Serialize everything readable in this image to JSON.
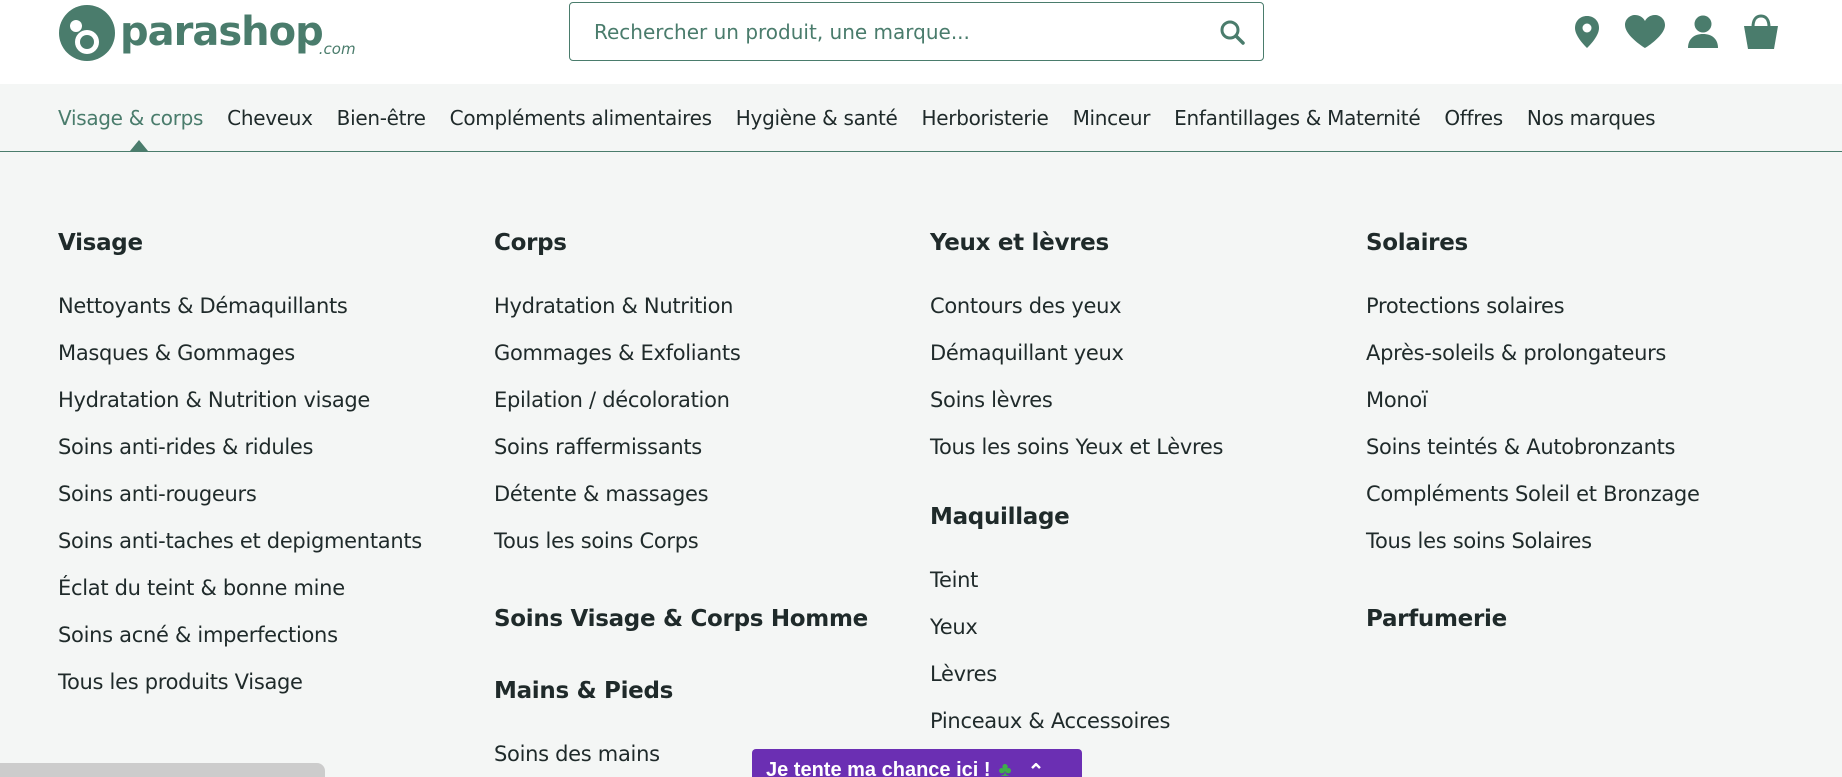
{
  "brand": {
    "name": "parashop",
    "suffix": ".com"
  },
  "search": {
    "placeholder": "Rechercher un produit, une marque..."
  },
  "header_icons": [
    "location-icon",
    "heart-icon",
    "user-icon",
    "basket-icon"
  ],
  "colors": {
    "accent": "#4a7c6c",
    "promo": "#6b2fb3",
    "background": "#f4f6f5"
  },
  "nav": {
    "items": [
      "Visage & corps",
      "Cheveux",
      "Bien-être",
      "Compléments alimentaires",
      "Hygiène & santé",
      "Herboristerie",
      "Minceur",
      "Enfantillages & Maternité",
      "Offres",
      "Nos marques"
    ],
    "active": "Visage & corps"
  },
  "menu": {
    "visage": {
      "title": "Visage",
      "links": [
        "Nettoyants & Démaquillants",
        "Masques & Gommages",
        "Hydratation & Nutrition visage",
        "Soins anti-rides & ridules",
        "Soins anti-rougeurs",
        "Soins anti-taches et depigmentants",
        "Éclat du teint & bonne mine",
        "Soins acné & imperfections",
        "Tous les produits Visage"
      ]
    },
    "corps": {
      "title": "Corps",
      "links": [
        "Hydratation & Nutrition",
        "Gommages & Exfoliants",
        "Epilation / décoloration",
        "Soins raffermissants",
        "Détente & massages",
        "Tous les soins Corps"
      ]
    },
    "homme": {
      "title": "Soins Visage & Corps Homme"
    },
    "mains": {
      "title": "Mains & Pieds",
      "links": [
        "Soins des mains"
      ]
    },
    "yeux": {
      "title": "Yeux et lèvres",
      "links": [
        "Contours des yeux",
        "Démaquillant yeux",
        "Soins lèvres",
        "Tous les soins Yeux et Lèvres"
      ]
    },
    "maquillage": {
      "title": "Maquillage",
      "links": [
        "Teint",
        "Yeux",
        "Lèvres",
        "Pinceaux & Accessoires"
      ]
    },
    "solaires": {
      "title": "Solaires",
      "links": [
        "Protections solaires",
        "Après-soleils & prolongateurs",
        "Monoï",
        "Soins teintés & Autobronzants",
        "Compléments Soleil et Bronzage",
        "Tous les soins Solaires"
      ]
    },
    "parfumerie": {
      "title": "Parfumerie"
    }
  },
  "promo": {
    "label": "Je tente ma chance ici !"
  }
}
